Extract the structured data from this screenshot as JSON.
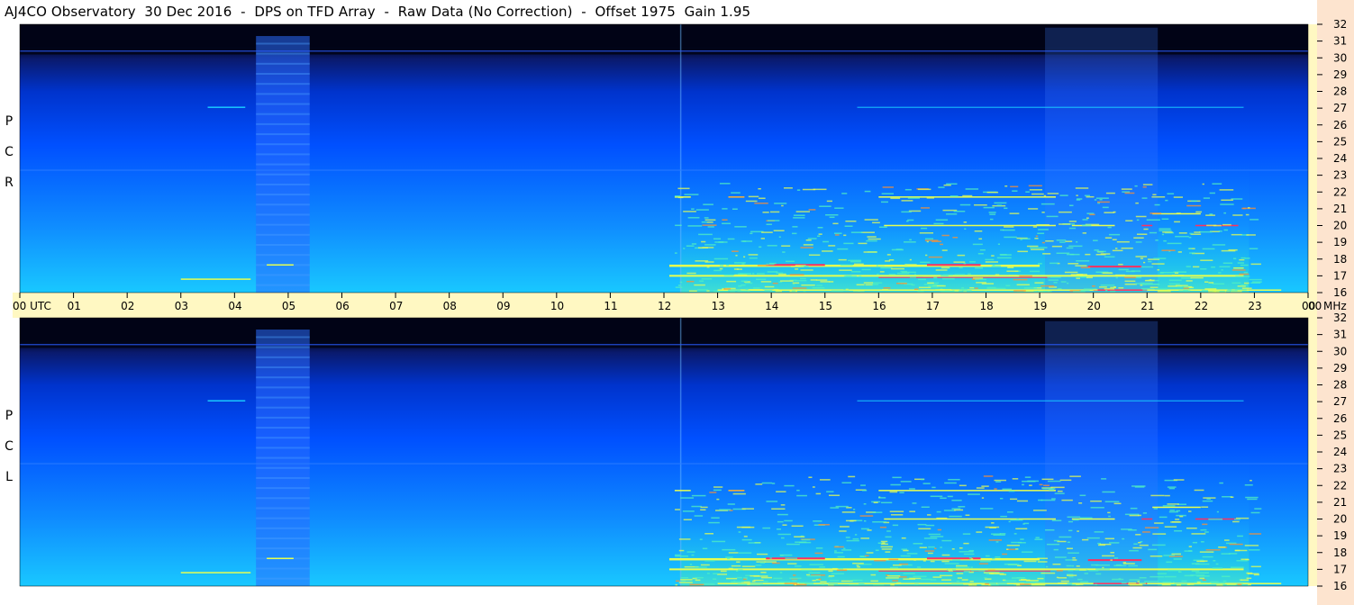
{
  "title": "AJ4CO Observatory  30 Dec 2016  -  DPS on TFD Array  -  Raw Data (No Correction)  -  Offset 1975  Gain 1.95",
  "chart_data": {
    "type": "heatmap",
    "title": "AJ4CO Observatory  30 Dec 2016  -  DPS on TFD Array  -  Raw Data (No Correction)  -  Offset 1975  Gain 1.95",
    "time_axis": {
      "ticks": [
        "00",
        "01",
        "02",
        "03",
        "04",
        "05",
        "06",
        "07",
        "08",
        "09",
        "10",
        "11",
        "12",
        "13",
        "14",
        "15",
        "16",
        "17",
        "18",
        "19",
        "20",
        "21",
        "22",
        "23",
        "00"
      ],
      "start_label": "00 UTC",
      "unit": "UTC",
      "range": [
        0,
        24
      ]
    },
    "freq_axis": {
      "ticks": [
        32,
        31,
        30,
        29,
        28,
        27,
        26,
        25,
        24,
        23,
        22,
        21,
        20,
        19,
        18,
        17,
        16
      ],
      "unit": "MHz",
      "range": [
        16,
        32
      ]
    },
    "panels": [
      {
        "polarization": "RCP",
        "label_letters": [
          "R",
          "C",
          "P"
        ]
      },
      {
        "polarization": "LCP",
        "label_letters": [
          "L",
          "C",
          "P"
        ]
      }
    ],
    "colors": {
      "noise_floor": "#0a1a6e",
      "background_low": "#0050ff",
      "background_mid": "#0f8cff",
      "band_high": "#19c8ff",
      "interference": "#e6ff50",
      "strong": "#ff3060",
      "top_cutoff": "#010416",
      "time_band": "#fff8c2",
      "freq_band": "#fde4cf"
    }
  }
}
